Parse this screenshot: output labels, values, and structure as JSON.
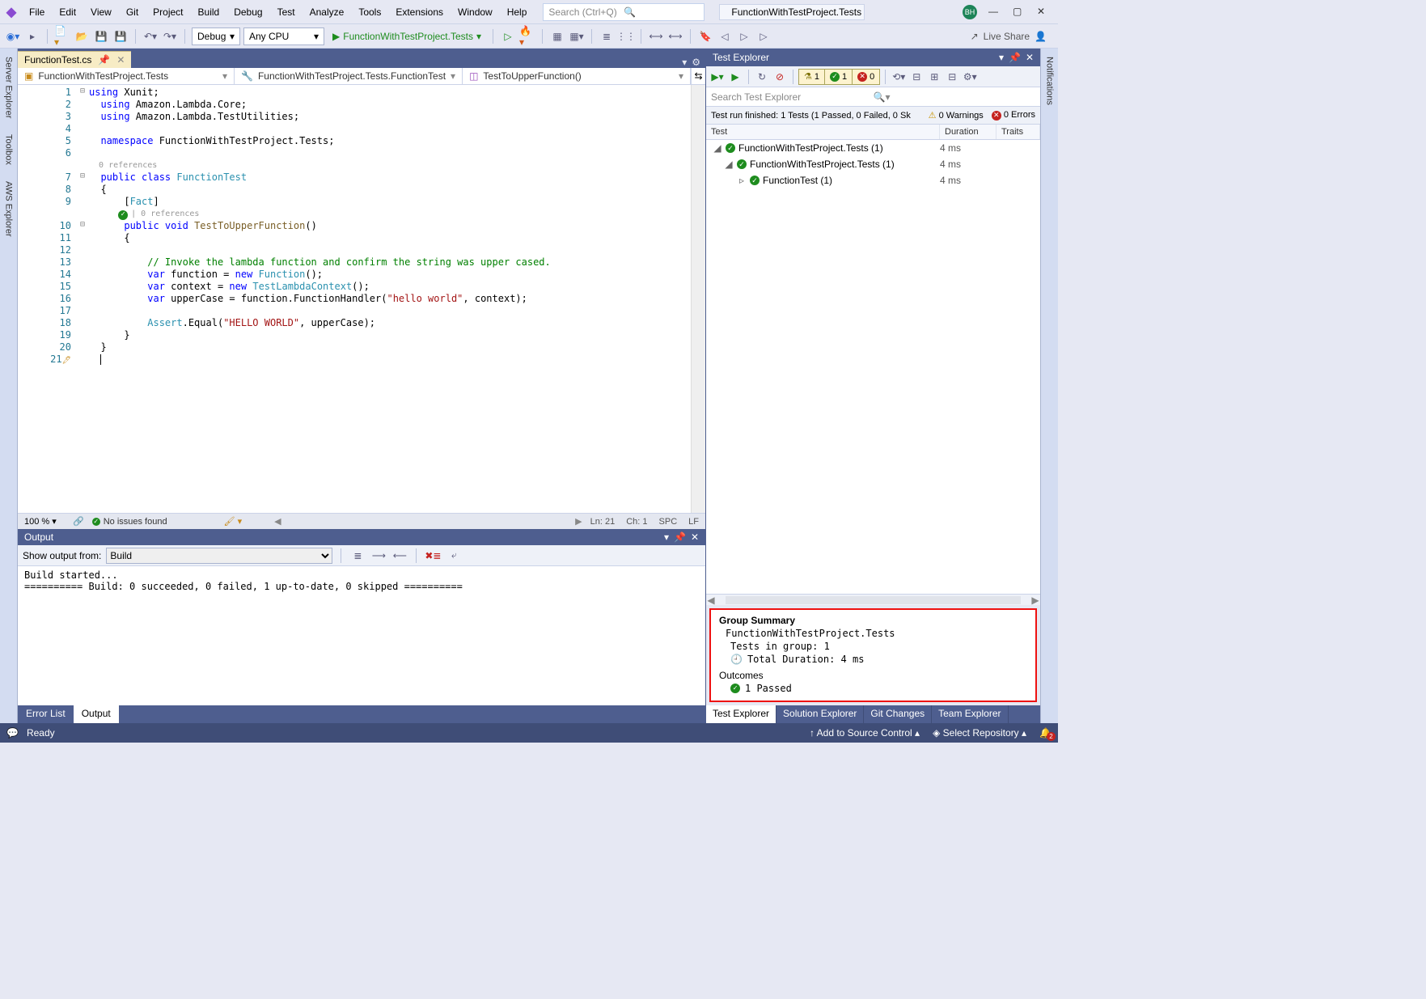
{
  "menu": [
    "File",
    "Edit",
    "View",
    "Git",
    "Project",
    "Build",
    "Debug",
    "Test",
    "Analyze",
    "Tools",
    "Extensions",
    "Window",
    "Help"
  ],
  "search_placeholder": "Search (Ctrl+Q)",
  "solution_name": "FunctionWithTestProject.Tests",
  "avatar_initials": "BH",
  "toolbar": {
    "config": "Debug",
    "platform": "Any CPU",
    "run_target": "FunctionWithTestProject.Tests",
    "live_share": "Live Share"
  },
  "left_strip": [
    "Server Explorer",
    "Toolbox",
    "AWS Explorer"
  ],
  "right_strip": [
    "Notifications"
  ],
  "doc_tab": "FunctionTest.cs",
  "nav": {
    "scope": "FunctionWithTestProject.Tests",
    "class": "FunctionWithTestProject.Tests.FunctionTest",
    "member": "TestToUpperFunction()"
  },
  "code_lines": [
    {
      "n": 1,
      "fold": "⊟",
      "html": "<span class='kw'>using</span> Xunit;"
    },
    {
      "n": 2,
      "html": "  <span class='kw'>using</span> Amazon.Lambda.Core;"
    },
    {
      "n": 3,
      "html": "  <span class='kw'>using</span> Amazon.Lambda.TestUtilities;"
    },
    {
      "n": 4,
      "html": ""
    },
    {
      "n": 5,
      "html": "  <span class='kw'>namespace</span> FunctionWithTestProject.Tests;"
    },
    {
      "n": 6,
      "html": ""
    },
    {
      "ref": "0 references"
    },
    {
      "n": 7,
      "fold": "⊟",
      "html": "  <span class='kw'>public class</span> <span class='type'>FunctionTest</span>"
    },
    {
      "n": 8,
      "html": "  {"
    },
    {
      "n": 9,
      "html": "      [<span class='type'>Fact</span>]"
    },
    {
      "ref": "<span class='ic-pass' style='margin-right:4px'>✓</span>| 0 references",
      "indent": "      "
    },
    {
      "n": 10,
      "fold": "⊟",
      "html": "      <span class='kw'>public void</span> <span style='color:#795e26'>TestToUpperFunction</span>()"
    },
    {
      "n": 11,
      "html": "      {"
    },
    {
      "n": 12,
      "html": ""
    },
    {
      "n": 13,
      "html": "          <span class='cmt'>// Invoke the lambda function and confirm the string was upper cased.</span>"
    },
    {
      "n": 14,
      "html": "          <span class='kw'>var</span> function = <span class='kw'>new</span> <span class='type'>Function</span>();"
    },
    {
      "n": 15,
      "html": "          <span class='kw'>var</span> context = <span class='kw'>new</span> <span class='type'>TestLambdaContext</span>();"
    },
    {
      "n": 16,
      "html": "          <span class='kw'>var</span> upperCase = function.FunctionHandler(<span class='str'>\"hello world\"</span>, context);"
    },
    {
      "n": 17,
      "html": ""
    },
    {
      "n": 18,
      "html": "          <span class='type'>Assert</span>.Equal(<span class='str'>\"HELLO WORLD\"</span>, upperCase);"
    },
    {
      "n": 19,
      "html": "      }"
    },
    {
      "n": 20,
      "html": "  }"
    },
    {
      "n": 21,
      "flag": "🖊",
      "html": "  <span class='cursor'></span>"
    }
  ],
  "editor_status": {
    "zoom": "100 %",
    "issues": "No issues found",
    "pos_ln": "Ln: 21",
    "pos_ch": "Ch: 1",
    "ins": "SPC",
    "enc": "LF"
  },
  "output": {
    "title": "Output",
    "from_label": "Show output from:",
    "source": "Build",
    "body": "Build started...\n========== Build: 0 succeeded, 0 failed, 1 up-to-date, 0 skipped =========="
  },
  "bottom_tabs": [
    "Error List",
    "Output"
  ],
  "test_explorer": {
    "title": "Test Explorer",
    "counters": {
      "total": "1",
      "pass": "1",
      "fail": "0"
    },
    "search_placeholder": "Search Test Explorer",
    "run_status": "Test run finished: 1 Tests (1 Passed, 0 Failed, 0 Sk",
    "warnings": "0 Warnings",
    "errors": "0 Errors",
    "cols": [
      "Test",
      "Duration",
      "Traits"
    ],
    "rows": [
      {
        "indent": 8,
        "chev": "◢",
        "name": "FunctionWithTestProject.Tests  (1)",
        "dur": "4 ms"
      },
      {
        "indent": 22,
        "chev": "◢",
        "name": "FunctionWithTestProject.Tests  (1)",
        "dur": "4 ms",
        "noicon": false
      },
      {
        "indent": 38,
        "chev": "▹",
        "name": "FunctionTest  (1)",
        "dur": "4 ms"
      }
    ],
    "summary": {
      "title": "Group Summary",
      "group": "FunctionWithTestProject.Tests",
      "tests_in_group": "Tests in group: 1",
      "duration": "Total Duration: 4 ms",
      "outcomes_label": "Outcomes",
      "passed": "1 Passed"
    },
    "bottom_tabs": [
      "Test Explorer",
      "Solution Explorer",
      "Git Changes",
      "Team Explorer"
    ]
  },
  "statusbar": {
    "ready": "Ready",
    "add_source": "Add to Source Control",
    "select_repo": "Select Repository",
    "notif_count": "2"
  }
}
